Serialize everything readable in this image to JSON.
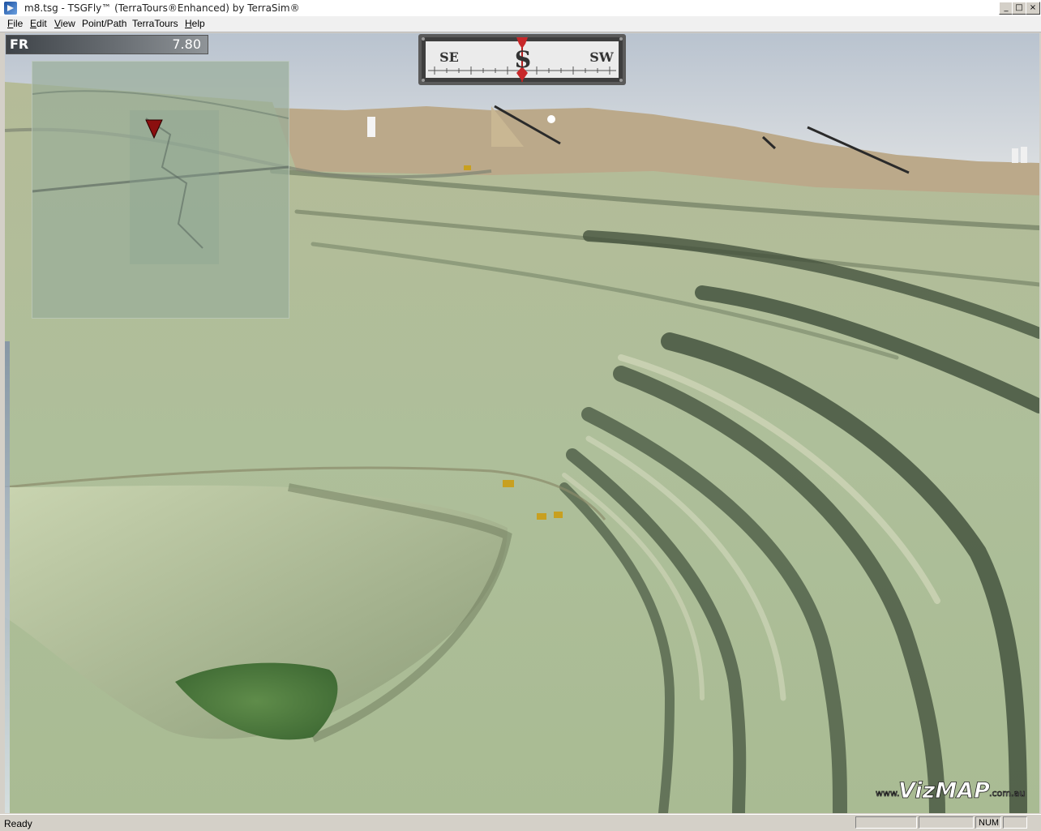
{
  "window": {
    "title": "m8.tsg - TSGFly™ (TerraTours®Enhanced) by TerraSim®",
    "buttons": {
      "minimize": "_",
      "maximize": "□",
      "close": "×"
    }
  },
  "menu": {
    "file": {
      "mnemonic": "F",
      "rest": "ile"
    },
    "edit": {
      "mnemonic": "E",
      "rest": "dit"
    },
    "view": {
      "mnemonic": "V",
      "rest": "iew"
    },
    "pointpath": {
      "label": "Point/Path"
    },
    "terratours": {
      "label": "TerraTours"
    },
    "help": {
      "mnemonic": "H",
      "rest": "elp"
    }
  },
  "hud": {
    "fr_label": "FR",
    "fr_value": "7.80"
  },
  "compass": {
    "left": "SE",
    "center": "S",
    "right": "SW"
  },
  "watermark": {
    "text_prefix": "www.",
    "text_brand": "VizMAP",
    "text_suffix": ".com.au"
  },
  "status": {
    "text": "Ready",
    "num": "NUM"
  },
  "colors": {
    "terrain": "#a8b894",
    "sky": "#c8d2dc",
    "pool": "#4e7a3e",
    "hud_red": "#a01818"
  }
}
